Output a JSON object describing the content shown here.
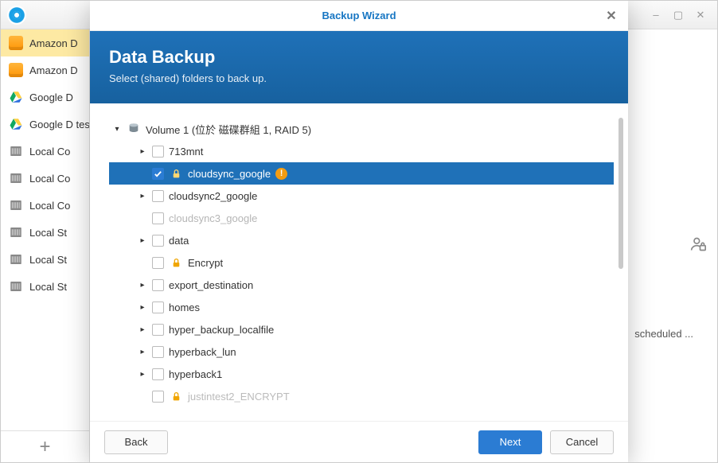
{
  "parent_window": {
    "title": "",
    "min_label": "–",
    "max_label": "▢",
    "close_label": "✕"
  },
  "sidebar": {
    "items": [
      {
        "label": "Amazon D",
        "icon": "amazon"
      },
      {
        "label": "Amazon D",
        "icon": "amazon"
      },
      {
        "label": "Google D",
        "icon": "gdrive"
      },
      {
        "label": "Google D test",
        "icon": "gdrive"
      },
      {
        "label": "Local Co",
        "icon": "storage"
      },
      {
        "label": "Local Co",
        "icon": "storage"
      },
      {
        "label": "Local Co",
        "icon": "storage"
      },
      {
        "label": "Local St",
        "icon": "storage"
      },
      {
        "label": "Local St",
        "icon": "storage"
      },
      {
        "label": "Local St",
        "icon": "storage"
      }
    ],
    "add_button": "+"
  },
  "right_area": {
    "user_lock_label": "",
    "scheduled_text": "scheduled ..."
  },
  "modal": {
    "title": "Backup Wizard",
    "close": "✕",
    "heading": "Data Backup",
    "subheading": "Select (shared) folders to back up.",
    "buttons": {
      "back": "Back",
      "next": "Next",
      "cancel": "Cancel"
    }
  },
  "tree": {
    "root": {
      "label": "Volume 1 (位於 磁碟群組 1, RAID 5)",
      "children": [
        {
          "label": "713mnt",
          "expand": true,
          "checked": false
        },
        {
          "label": "cloudsync_google",
          "expand": false,
          "checked": true,
          "selected": true,
          "lock": true,
          "warn": true
        },
        {
          "label": "cloudsync2_google",
          "expand": true,
          "checked": false
        },
        {
          "label": "cloudsync3_google",
          "expand": false,
          "checked": false,
          "disabled": true
        },
        {
          "label": "data",
          "expand": true,
          "checked": false
        },
        {
          "label": "Encrypt",
          "expand": false,
          "checked": false,
          "lock": true
        },
        {
          "label": "export_destination",
          "expand": true,
          "checked": false
        },
        {
          "label": "homes",
          "expand": true,
          "checked": false
        },
        {
          "label": "hyper_backup_localfile",
          "expand": true,
          "checked": false
        },
        {
          "label": "hyperback_lun",
          "expand": true,
          "checked": false
        },
        {
          "label": "hyperback1",
          "expand": true,
          "checked": false
        },
        {
          "label": "justintest2_ENCRYPT",
          "expand": false,
          "checked": false,
          "lock": true,
          "fade": true
        }
      ]
    }
  }
}
